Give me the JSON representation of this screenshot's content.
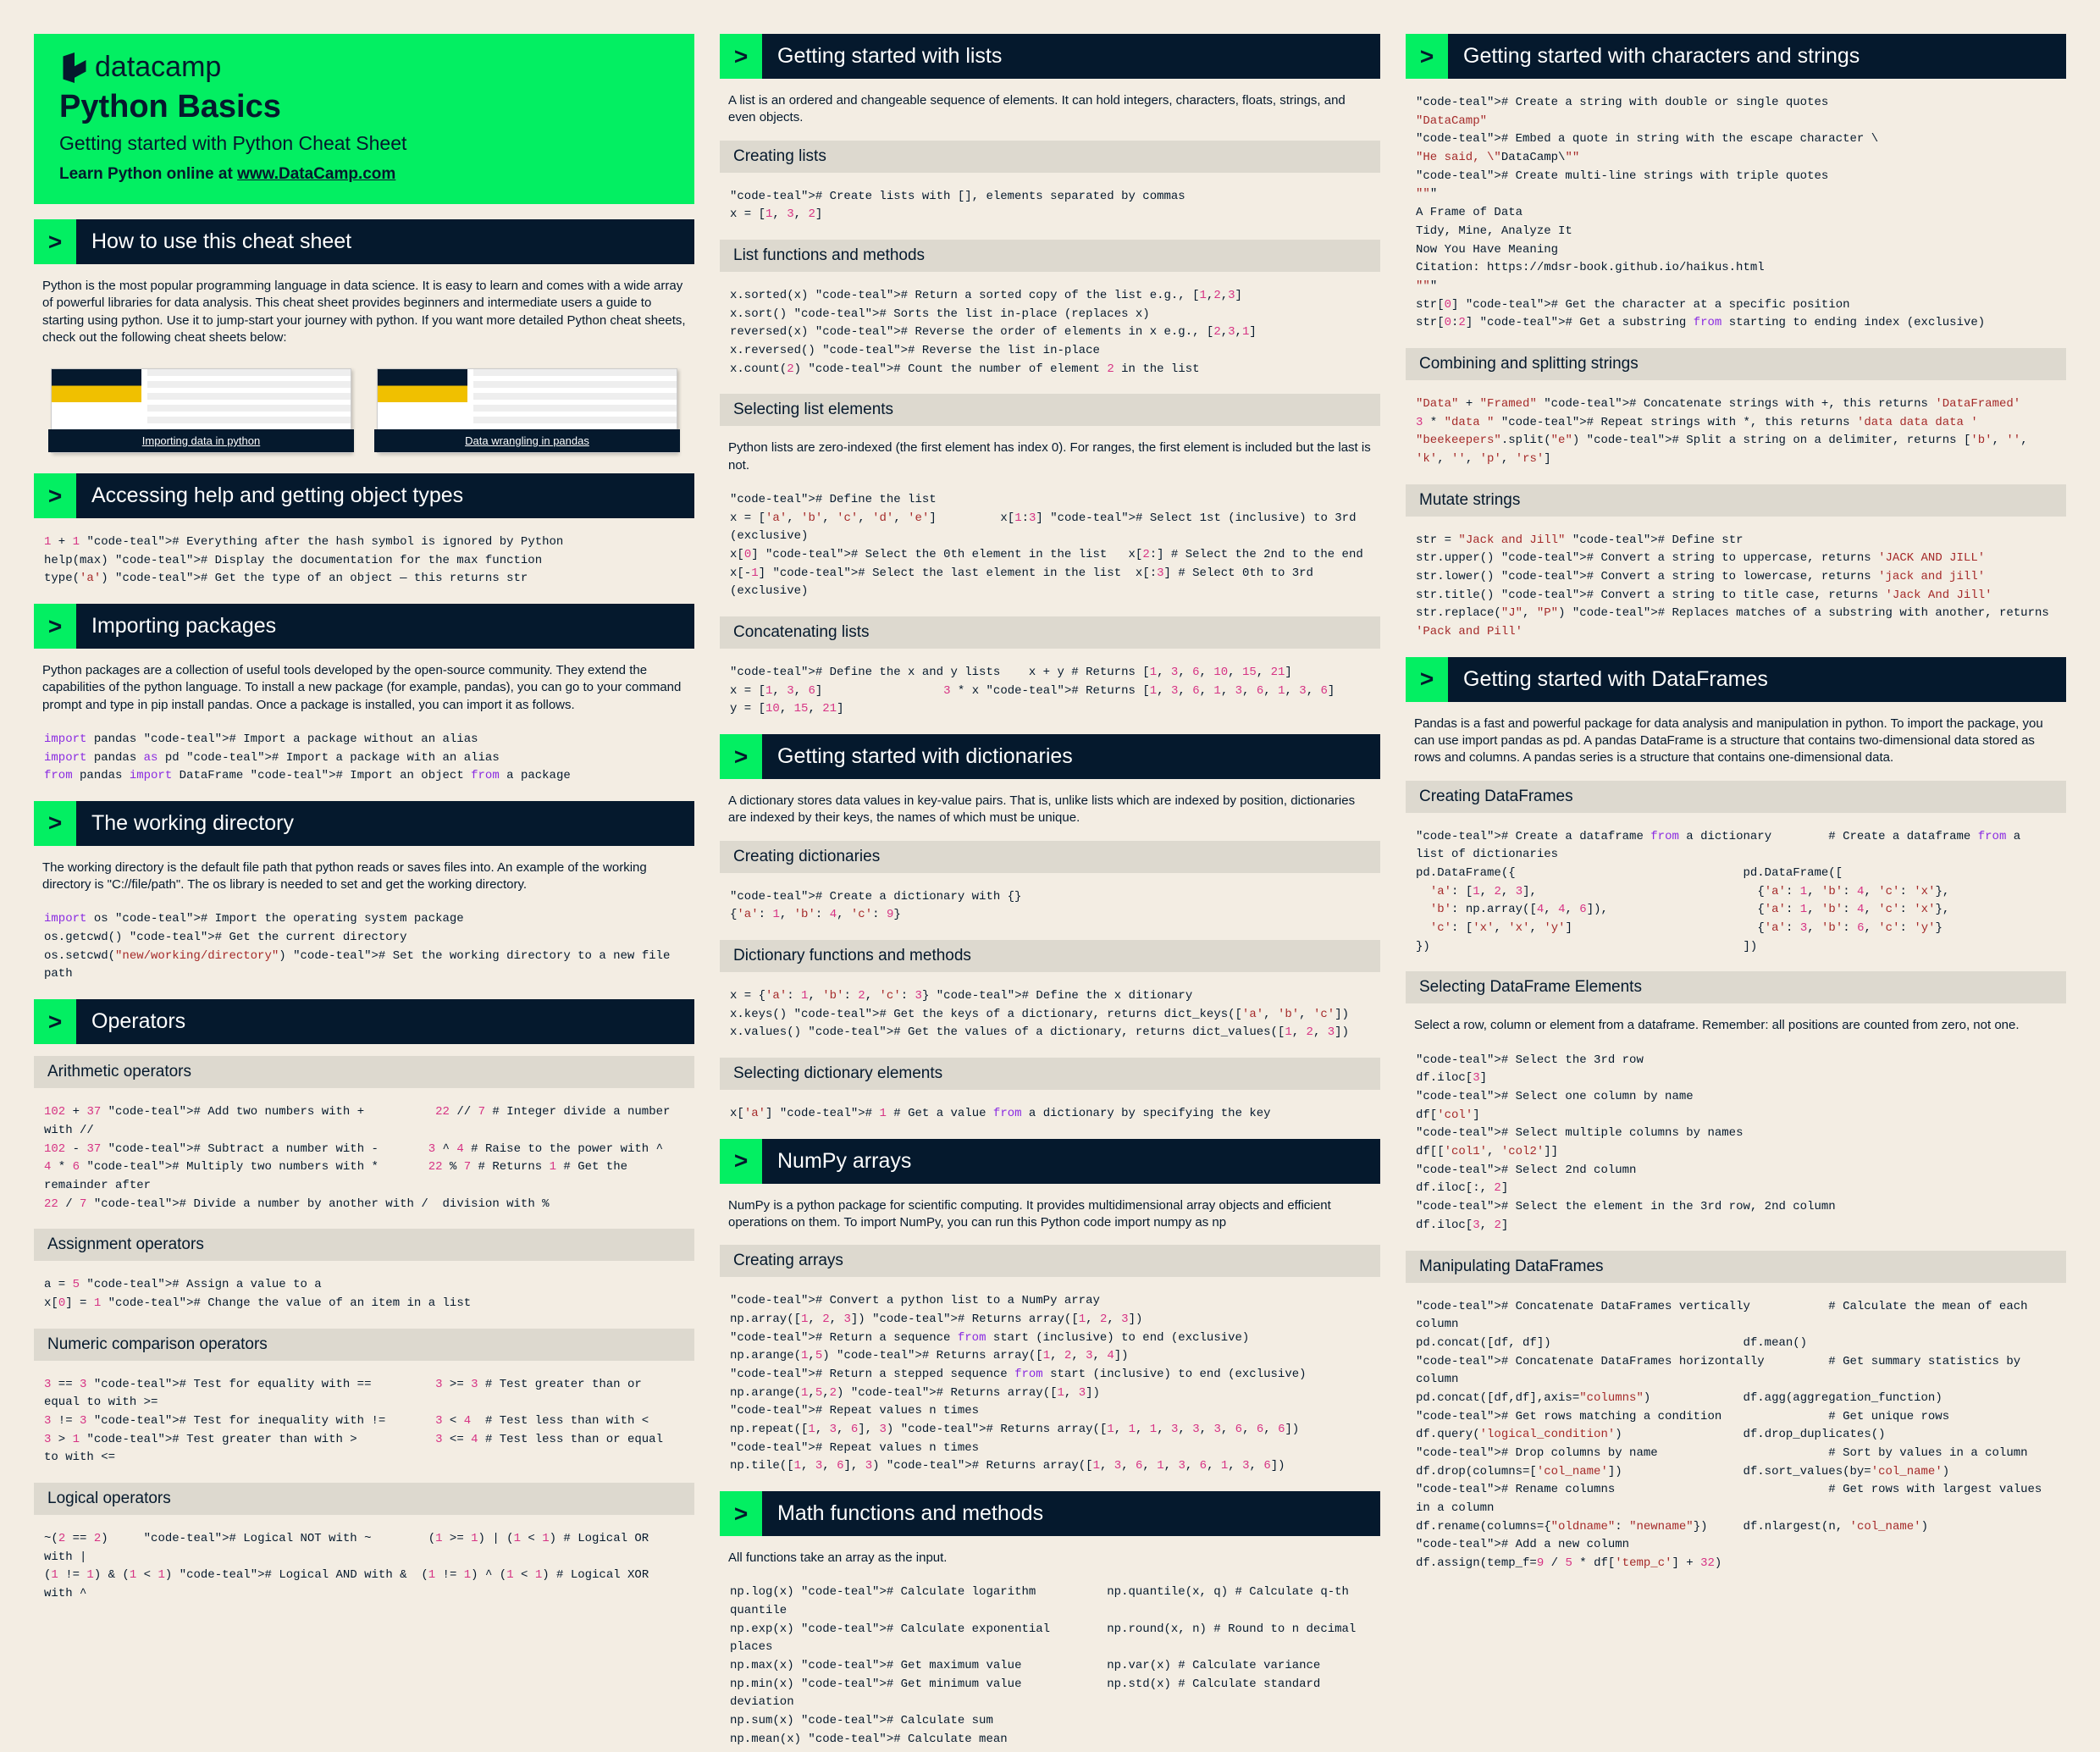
{
  "brand": "datacamp",
  "title": "Python Basics",
  "subtitle": "Getting started with Python Cheat Sheet",
  "learn_prefix": "Learn Python online at ",
  "learn_link": "www.DataCamp.com",
  "s": {
    "howto": "How to use this cheat sheet",
    "howto_desc": "Python is the most popular programming language in data science. It is easy to learn and comes with a wide array of powerful libraries for data analysis. This cheat sheet provides beginners and intermediate users a guide to starting using python. Use it to jump-start your journey with python. If you want more detailed Python cheat sheets, check out the following cheat sheets below:",
    "thumb1": "Importing data in python",
    "thumb2": "Data wrangling in pandas",
    "help": "Accessing help and getting object types",
    "import": "Importing packages",
    "import_desc": "Python packages are a collection of useful tools developed by the open-source community. They extend the capabilities of the python language. To install a new package (for example, pandas), you can go to your command prompt and type in pip install pandas. Once a package is installed, you can import it as follows.",
    "workdir": "The working directory",
    "workdir_desc": "The working directory is the default file path that python reads or saves files into. An example of the working directory is \"C://file/path\". The os library is needed to set and get the working directory.",
    "operators": "Operators",
    "op_arith": "Arithmetic operators",
    "op_assign": "Assignment operators",
    "op_compare": "Numeric comparison operators",
    "op_logical": "Logical operators",
    "lists": "Getting started with lists",
    "lists_desc": "A list is an ordered and changeable sequence of elements. It can hold integers, characters, floats, strings, and even objects.",
    "lists_create": "Creating lists",
    "lists_fun": "List functions and methods",
    "lists_sel": "Selecting list elements",
    "lists_sel_desc": "Python lists are zero-indexed (the first element has index 0). For ranges, the first element is included but the last is not.",
    "lists_cat": "Concatenating lists",
    "dicts": "Getting started with dictionaries",
    "dicts_desc": "A dictionary stores data values in key-value pairs. That is, unlike lists which are indexed by position, dictionaries are indexed by their keys, the names of which must be unique.",
    "dicts_create": "Creating dictionaries",
    "dicts_fun": "Dictionary functions and methods",
    "dicts_sel": "Selecting dictionary elements",
    "numpy": "NumPy arrays",
    "numpy_desc": "NumPy is a python package for scientific computing. It provides multidimensional array objects and efficient operations on them. To import NumPy, you can run this Python code import numpy as np",
    "numpy_create": "Creating arrays",
    "math": "Math functions and methods",
    "math_desc": "All functions take an array as the input.",
    "strings": "Getting started with characters and strings",
    "str_combine": "Combining and splitting strings",
    "str_mutate": "Mutate strings",
    "dataframes": "Getting started with DataFrames",
    "df_desc": "Pandas is a fast and powerful package for data analysis and manipulation in python. To import the package, you can use import pandas as pd. A pandas DataFrame is a structure that contains two-dimensional data stored as rows and columns. A pandas series is a structure that contains one-dimensional data.",
    "df_create": "Creating DataFrames",
    "df_sel": "Selecting DataFrame Elements",
    "df_sel_desc": "Select a row, column or element from a dataframe. Remember: all positions are counted from zero, not one.",
    "df_manip": "Manipulating DataFrames"
  },
  "code": {
    "help": "1 + 1 # Everything after the hash symbol is ignored by Python\nhelp(max) # Display the documentation for the max function\ntype('a') # Get the type of an object — this returns str",
    "import": "import pandas # Import a package without an alias\nimport pandas as pd # Import a package with an alias\nfrom pandas import DataFrame # Import an object from a package",
    "workdir": "import os # Import the operating system package\nos.getcwd() # Get the current directory\nos.setcwd(\"new/working/directory\") # Set the working directory to a new file path",
    "arith": "102 + 37 # Add two numbers with +          22 // 7 # Integer divide a number with //\n102 - 37 # Subtract a number with -       3 ^ 4 # Raise to the power with ^\n4 * 6 # Multiply two numbers with *       22 % 7 # Returns 1 # Get the remainder after\n22 / 7 # Divide a number by another with /  division with %",
    "assign": "a = 5 # Assign a value to a\nx[0] = 1 # Change the value of an item in a list",
    "compare": "3 == 3 # Test for equality with ==         3 >= 3 # Test greater than or equal to with >=\n3 != 3 # Test for inequality with !=       3 < 4  # Test less than with <\n3 > 1 # Test greater than with >           3 <= 4 # Test less than or equal to with <=",
    "logical": "~(2 == 2)     # Logical NOT with ~        (1 >= 1) | (1 < 1) # Logical OR with |\n(1 != 1) & (1 < 1) # Logical AND with &  (1 != 1) ^ (1 < 1) # Logical XOR with ^",
    "list_create": "# Create lists with [], elements separated by commas\nx = [1, 3, 2]",
    "list_fun": "x.sorted(x) # Return a sorted copy of the list e.g., [1,2,3]\nx.sort() # Sorts the list in-place (replaces x)\nreversed(x) # Reverse the order of elements in x e.g., [2,3,1]\nx.reversed() # Reverse the list in-place\nx.count(2) # Count the number of element 2 in the list",
    "list_sel": "# Define the list\nx = ['a', 'b', 'c', 'd', 'e']         x[1:3] # Select 1st (inclusive) to 3rd (exclusive)\nx[0] # Select the 0th element in the list   x[2:] # Select the 2nd to the end\nx[-1] # Select the last element in the list  x[:3] # Select 0th to 3rd (exclusive)",
    "list_cat": "# Define the x and y lists    x + y # Returns [1, 3, 6, 10, 15, 21]\nx = [1, 3, 6]                 3 * x # Returns [1, 3, 6, 1, 3, 6, 1, 3, 6]\ny = [10, 15, 21]",
    "dict_create": "# Create a dictionary with {}\n{'a': 1, 'b': 4, 'c': 9}",
    "dict_fun": "x = {'a': 1, 'b': 2, 'c': 3} # Define the x ditionary\nx.keys() # Get the keys of a dictionary, returns dict_keys(['a', 'b', 'c'])\nx.values() # Get the values of a dictionary, returns dict_values([1, 2, 3])",
    "dict_sel": "x['a'] # 1 # Get a value from a dictionary by specifying the key",
    "numpy_create": "# Convert a python list to a NumPy array\nnp.array([1, 2, 3]) # Returns array([1, 2, 3])\n# Return a sequence from start (inclusive) to end (exclusive)\nnp.arange(1,5) # Returns array([1, 2, 3, 4])\n# Return a stepped sequence from start (inclusive) to end (exclusive)\nnp.arange(1,5,2) # Returns array([1, 3])\n# Repeat values n times\nnp.repeat([1, 3, 6], 3) # Returns array([1, 1, 1, 3, 3, 3, 6, 6, 6])\n# Repeat values n times\nnp.tile([1, 3, 6], 3) # Returns array([1, 3, 6, 1, 3, 6, 1, 3, 6])",
    "math": "np.log(x) # Calculate logarithm          np.quantile(x, q) # Calculate q-th quantile\nnp.exp(x) # Calculate exponential        np.round(x, n) # Round to n decimal places\nnp.max(x) # Get maximum value            np.var(x) # Calculate variance\nnp.min(x) # Get minimum value            np.std(x) # Calculate standard deviation\nnp.sum(x) # Calculate sum\nnp.mean(x) # Calculate mean",
    "strings": "# Create a string with double or single quotes\n\"DataCamp\"\n# Embed a quote in string with the escape character \\\n\"He said, \\\"DataCamp\\\"\"\n# Create multi-line strings with triple quotes\n\"\"\"\nA Frame of Data\nTidy, Mine, Analyze It\nNow You Have Meaning\nCitation: https://mdsr-book.github.io/haikus.html\n\"\"\"\nstr[0] # Get the character at a specific position\nstr[0:2] # Get a substring from starting to ending index (exclusive)",
    "str_combine": "\"Data\" + \"Framed\" # Concatenate strings with +, this returns 'DataFramed'\n3 * \"data \" # Repeat strings with *, this returns 'data data data '\n\"beekeepers\".split(\"e\") # Split a string on a delimiter, returns ['b', '', 'k', '', 'p', 'rs']",
    "str_mutate": "str = \"Jack and Jill\" # Define str\nstr.upper() # Convert a string to uppercase, returns 'JACK AND JILL'\nstr.lower() # Convert a string to lowercase, returns 'jack and jill'\nstr.title() # Convert a string to title case, returns 'Jack And Jill'\nstr.replace(\"J\", \"P\") # Replaces matches of a substring with another, returns 'Pack and Pill'",
    "df_create": "# Create a dataframe from a dictionary        # Create a dataframe from a list of dictionaries\npd.DataFrame({                                pd.DataFrame([\n  'a': [1, 2, 3],                               {'a': 1, 'b': 4, 'c': 'x'},\n  'b': np.array([4, 4, 6]),                     {'a': 1, 'b': 4, 'c': 'x'},\n  'c': ['x', 'x', 'y']                          {'a': 3, 'b': 6, 'c': 'y'}\n})                                            ])",
    "df_sel": "# Select the 3rd row\ndf.iloc[3]\n# Select one column by name\ndf['col']\n# Select multiple columns by names\ndf[['col1', 'col2']]\n# Select 2nd column\ndf.iloc[:, 2]\n# Select the element in the 3rd row, 2nd column\ndf.iloc[3, 2]",
    "df_manip": "# Concatenate DataFrames vertically           # Calculate the mean of each column\npd.concat([df, df])                           df.mean()\n# Concatenate DataFrames horizontally         # Get summary statistics by column\npd.concat([df,df],axis=\"columns\")             df.agg(aggregation_function)\n# Get rows matching a condition               # Get unique rows\ndf.query('logical_condition')                 df.drop_duplicates()\n# Drop columns by name                        # Sort by values in a column\ndf.drop(columns=['col_name'])                 df.sort_values(by='col_name')\n# Rename columns                              # Get rows with largest values in a column\ndf.rename(columns={\"oldname\": \"newname\"})     df.nlargest(n, 'col_name')\n# Add a new column\ndf.assign(temp_f=9 / 5 * df['temp_c'] + 32)"
  }
}
